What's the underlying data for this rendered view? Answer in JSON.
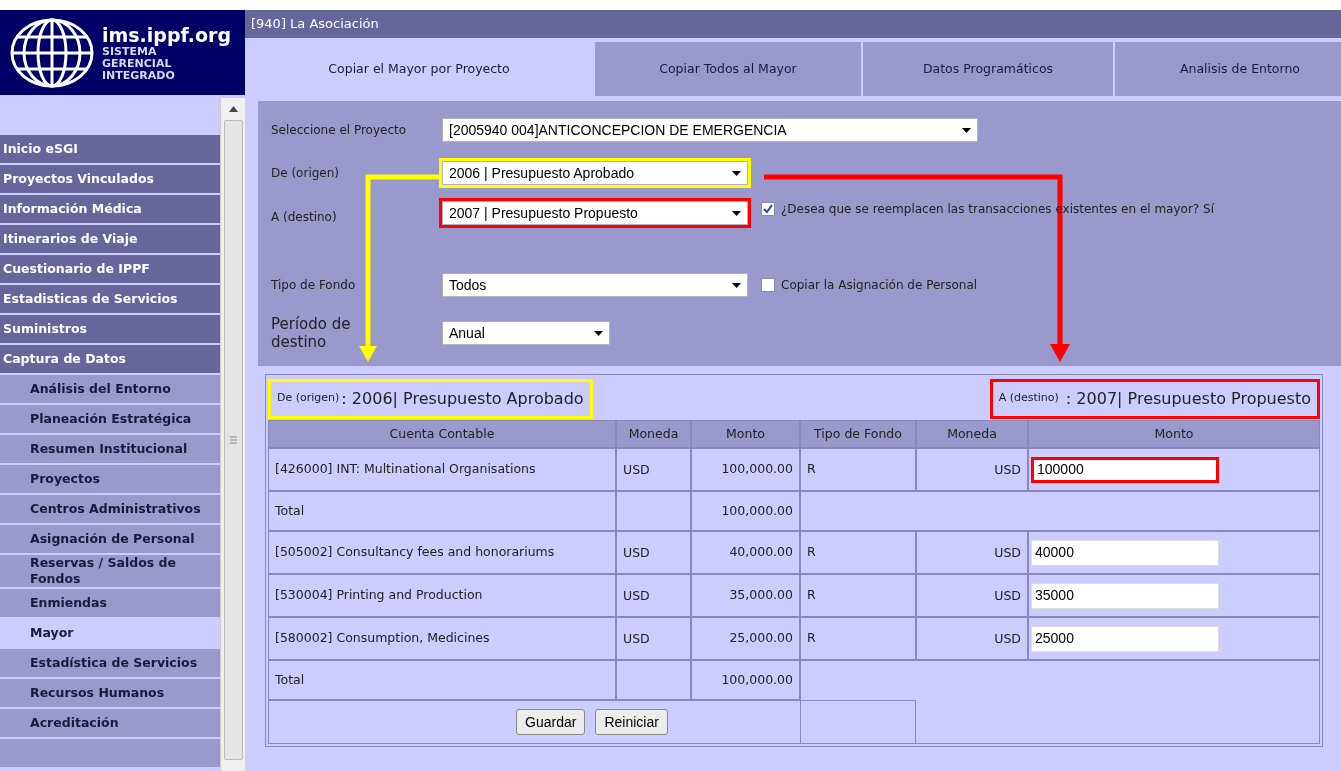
{
  "logo": {
    "title": "ims.ippf.org",
    "subtitle": [
      "SISTEMA",
      "GERENCIAL",
      "INTEGRADO"
    ]
  },
  "org_bar": {
    "title": "[940] La Asociación"
  },
  "tabs": [
    {
      "label": "Copiar el Mayor por Proyecto",
      "selected": true
    },
    {
      "label": "Copiar Todos al Mayor",
      "selected": false
    },
    {
      "label": "Datos Programáticos",
      "selected": false
    },
    {
      "label": "Analisis de Entorno",
      "selected": false
    }
  ],
  "sidebar": {
    "items": [
      {
        "label": "Inicio eSGI",
        "kind": "section",
        "selected": false
      },
      {
        "label": "Proyectos Vinculados",
        "kind": "section",
        "selected": false
      },
      {
        "label": "Información Médica",
        "kind": "section",
        "selected": false
      },
      {
        "label": "Itinerarios de Viaje",
        "kind": "section",
        "selected": false
      },
      {
        "label": "Cuestionario de IPPF",
        "kind": "section",
        "selected": false
      },
      {
        "label": "Estadisticas de Servicios",
        "kind": "section",
        "selected": false
      },
      {
        "label": "Suministros",
        "kind": "section",
        "selected": false
      },
      {
        "label": "Captura de Datos",
        "kind": "section",
        "selected": false
      },
      {
        "label": "Análisis del Entorno",
        "kind": "sub",
        "selected": false
      },
      {
        "label": "Planeación Estratégica",
        "kind": "sub",
        "selected": false
      },
      {
        "label": "Resumen Institucional",
        "kind": "sub",
        "selected": false
      },
      {
        "label": "Proyectos",
        "kind": "sub",
        "selected": false
      },
      {
        "label": "Centros Administrativos",
        "kind": "sub",
        "selected": false
      },
      {
        "label": "Asignación de Personal",
        "kind": "sub",
        "selected": false
      },
      {
        "label": "Reservas / Saldos de Fondos",
        "kind": "sub",
        "selected": false
      },
      {
        "label": "Enmiendas",
        "kind": "sub",
        "selected": false
      },
      {
        "label": "Mayor",
        "kind": "sub",
        "selected": true
      },
      {
        "label": "Estadística de Servicios",
        "kind": "sub",
        "selected": false
      },
      {
        "label": "Recursos Humanos",
        "kind": "sub",
        "selected": false
      },
      {
        "label": "Acreditación",
        "kind": "sub",
        "selected": false
      }
    ]
  },
  "form": {
    "fields": [
      {
        "label": "Seleccione el Proyecto",
        "value": "[2005940 004]ANTICONCEPCION DE EMERGENCIA",
        "highlight": false
      },
      {
        "label": "De (origen)",
        "value": "2006 | Presupuesto Aprobado",
        "highlight": true,
        "color": "#ffff00"
      },
      {
        "label": "A (destino)",
        "value": "2007 | Presupuesto Propuesto",
        "highlight": true,
        "color": "#ff0000",
        "checkbox": {
          "label": "¿Desea que se reemplacen las transacciones existentes en el mayor? Sí",
          "checked": true
        }
      },
      {
        "label": "Tipo de Fondo",
        "value": "Todos",
        "highlight": false,
        "checkbox": {
          "label": "Copiar la Asignación de Personal",
          "checked": false
        }
      },
      {
        "label": "Período de destino",
        "value": "Anual",
        "highlight": false
      }
    ]
  },
  "ledger": {
    "origin_label": "De (origen)",
    "origin_value": ": 2006| Presupuesto Aprobado",
    "destination_label": "A (destino)",
    "destination_value": " : 2007| Presupuesto Propuesto",
    "columns": [
      "Cuenta Contable",
      "Moneda",
      "Monto",
      "Tipo de Fondo",
      "Moneda",
      "Monto"
    ],
    "rows": [
      {
        "kind": "account",
        "account": "[426000] INT: Multinational Organisations",
        "currency": "USD",
        "amount": "100,000.00",
        "fund_type": "R",
        "dest_currency": "USD",
        "dest_amount": "100000",
        "highlight": true
      },
      {
        "kind": "total",
        "label": "Total",
        "amount": "100,000.00"
      },
      {
        "kind": "account",
        "account": "[505002] Consultancy fees and honorariums",
        "currency": "USD",
        "amount": "40,000.00",
        "fund_type": "R",
        "dest_currency": "USD",
        "dest_amount": "40000",
        "highlight": false
      },
      {
        "kind": "account",
        "account": "[530004] Printing and Production",
        "currency": "USD",
        "amount": "35,000.00",
        "fund_type": "R",
        "dest_currency": "USD",
        "dest_amount": "35000",
        "highlight": false
      },
      {
        "kind": "account",
        "account": "[580002] Consumption, Medicines",
        "currency": "USD",
        "amount": "25,000.00",
        "fund_type": "R",
        "dest_currency": "USD",
        "dest_amount": "25000",
        "highlight": false
      },
      {
        "kind": "total",
        "label": "Total",
        "amount": "100,000.00"
      }
    ],
    "buttons": [
      "Guardar",
      "Reiniciar"
    ]
  }
}
